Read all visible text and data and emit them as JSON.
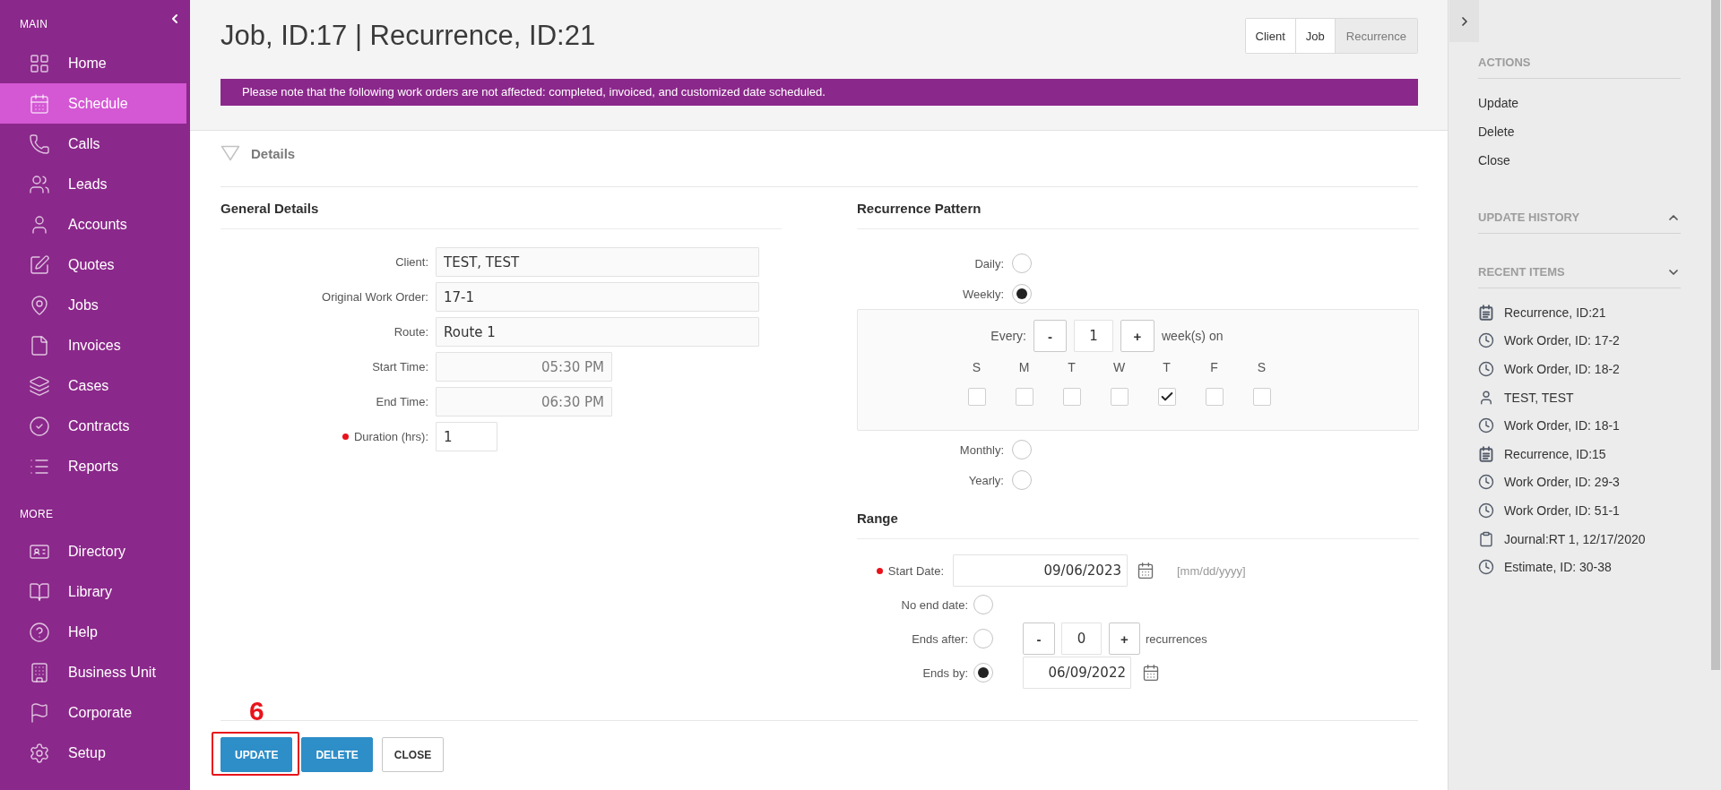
{
  "sidebar": {
    "sections": [
      {
        "title": "MAIN",
        "items": [
          {
            "label": "Home",
            "selected": false
          },
          {
            "label": "Schedule",
            "selected": true
          },
          {
            "label": "Calls",
            "selected": false
          },
          {
            "label": "Leads",
            "selected": false
          },
          {
            "label": "Accounts",
            "selected": false
          },
          {
            "label": "Quotes",
            "selected": false
          },
          {
            "label": "Jobs",
            "selected": false
          },
          {
            "label": "Invoices",
            "selected": false
          },
          {
            "label": "Cases",
            "selected": false
          },
          {
            "label": "Contracts",
            "selected": false
          },
          {
            "label": "Reports",
            "selected": false
          }
        ]
      },
      {
        "title": "MORE",
        "items": [
          {
            "label": "Directory",
            "selected": false
          },
          {
            "label": "Library",
            "selected": false
          },
          {
            "label": "Help",
            "selected": false
          },
          {
            "label": "Business Unit",
            "selected": false
          },
          {
            "label": "Corporate",
            "selected": false
          },
          {
            "label": "Setup",
            "selected": false
          }
        ]
      }
    ]
  },
  "header": {
    "title": "Job, ID:17 | Recurrence, ID:21",
    "tabs": [
      {
        "label": "Client",
        "selected": false
      },
      {
        "label": "Job",
        "selected": false
      },
      {
        "label": "Recurrence",
        "selected": true
      }
    ],
    "notice": "Please note that the following work orders are not affected: completed, invoiced, and customized date scheduled."
  },
  "details": {
    "title": "Details",
    "expanded": true
  },
  "general_details": {
    "title": "General Details",
    "fields": [
      {
        "label": "Client:",
        "value": "TEST, TEST",
        "kind": "text",
        "required": false,
        "disabled": false
      },
      {
        "label": "Original Work Order:",
        "value": "17-1",
        "kind": "text",
        "required": false,
        "disabled": false
      },
      {
        "label": "Route:",
        "value": "Route 1",
        "kind": "text",
        "required": false,
        "disabled": false
      },
      {
        "label": "Start Time:",
        "value": "05:30 PM",
        "kind": "time",
        "required": false,
        "disabled": true
      },
      {
        "label": "End Time:",
        "value": "06:30 PM",
        "kind": "time",
        "required": false,
        "disabled": true
      },
      {
        "label": "Duration (hrs):",
        "value": "1",
        "kind": "number",
        "required": true,
        "disabled": false
      }
    ]
  },
  "recurrence_pattern": {
    "title": "Recurrence Pattern",
    "options": [
      {
        "label": "Daily:",
        "selected": false
      },
      {
        "label": "Weekly:",
        "selected": true
      },
      {
        "label": "Monthly:",
        "selected": false
      },
      {
        "label": "Yearly:",
        "selected": false
      }
    ],
    "weekly": {
      "every_label": "Every:",
      "decrement": "-",
      "value": "1",
      "increment": "+",
      "unit": "week(s) on",
      "days": [
        {
          "label": "S",
          "checked": false
        },
        {
          "label": "M",
          "checked": false
        },
        {
          "label": "T",
          "checked": false
        },
        {
          "label": "W",
          "checked": false
        },
        {
          "label": "T",
          "checked": true
        },
        {
          "label": "F",
          "checked": false
        },
        {
          "label": "S",
          "checked": false
        }
      ]
    }
  },
  "range": {
    "title": "Range",
    "start_date": {
      "label": "Start Date:",
      "value": "09/06/2023",
      "format_hint": "[mm/dd/yyyy]",
      "required": true
    },
    "end_options": [
      {
        "kind": "none",
        "label": "No end date:",
        "selected": false
      },
      {
        "kind": "count",
        "label": "Ends after:",
        "selected": false,
        "decrement": "-",
        "value": "0",
        "increment": "+",
        "unit": "recurrences"
      },
      {
        "kind": "date",
        "label": "Ends by:",
        "selected": true,
        "value": "06/09/2022"
      }
    ]
  },
  "buttons": [
    {
      "label": "UPDATE",
      "kind": "primary",
      "annotation": "6"
    },
    {
      "label": "DELETE",
      "kind": "primary"
    },
    {
      "label": "CLOSE",
      "kind": "secondary"
    }
  ],
  "side_panel": {
    "actions": {
      "title": "ACTIONS",
      "items": [
        "Update",
        "Delete",
        "Close"
      ]
    },
    "update_history": {
      "title": "UPDATE HISTORY",
      "expanded": false
    },
    "recent_items": {
      "title": "RECENT ITEMS",
      "expanded": true,
      "items": [
        {
          "kind": "recurrence",
          "label": "Recurrence, ID:21"
        },
        {
          "kind": "workorder",
          "label": "Work Order, ID: 17-2"
        },
        {
          "kind": "workorder",
          "label": "Work Order, ID: 18-2"
        },
        {
          "kind": "contact",
          "label": "TEST, TEST"
        },
        {
          "kind": "workorder",
          "label": "Work Order, ID: 18-1"
        },
        {
          "kind": "recurrence",
          "label": "Recurrence, ID:15"
        },
        {
          "kind": "workorder",
          "label": "Work Order, ID: 29-3"
        },
        {
          "kind": "workorder",
          "label": "Work Order, ID: 51-1"
        },
        {
          "kind": "journal",
          "label": "Journal:RT 1, 12/17/2020"
        },
        {
          "kind": "estimate",
          "label": "Estimate, ID: 30-38"
        }
      ]
    }
  }
}
